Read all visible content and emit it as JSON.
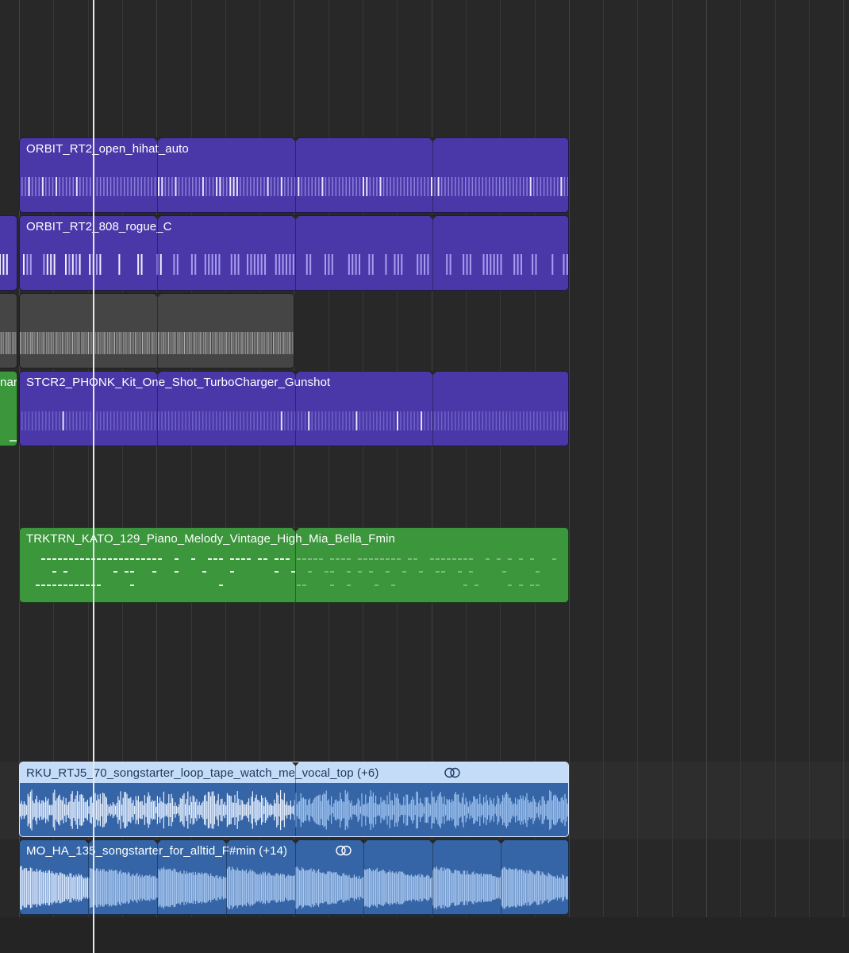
{
  "arrange": {
    "tracks": [
      {
        "id": "hihat",
        "regions": [
          {
            "name": "ORBIT_RT2_open_hihat_auto",
            "color": "#4b38a8"
          }
        ]
      },
      {
        "id": "808",
        "regions": [
          {
            "name": "ORBIT_RT2_808_rogue_C",
            "color": "#4b38a8"
          }
        ]
      },
      {
        "id": "grey",
        "regions": [
          {
            "name": "",
            "color": "#454545"
          }
        ]
      },
      {
        "id": "gunshot",
        "regions": [
          {
            "name": "nar",
            "color": "#3b963c"
          },
          {
            "name": "STCR2_PHONK_Kit_One_Shot_TurboCharger_Gunshot",
            "color": "#4b38a8"
          }
        ]
      },
      {
        "id": "piano",
        "regions": [
          {
            "name": "TRKTRN_KATO_129_Piano_Melody_Vintage_High_Mia_Bella_Fmin",
            "color": "#3b963c"
          }
        ]
      },
      {
        "id": "vocal",
        "regions": [
          {
            "name": "RKU_RTJ5_70_songstarter_loop_tape_watch_me_vocal_top (+6)",
            "color": "#c5dcf8",
            "selected": true
          }
        ]
      },
      {
        "id": "songstarter",
        "regions": [
          {
            "name": "MO_HA_135_songstarter_for_alltid_F#min (+14)",
            "color": "#3565a6"
          }
        ]
      }
    ],
    "link_icon": "linked-rings-icon",
    "playhead_color": "#e8e8e8"
  }
}
